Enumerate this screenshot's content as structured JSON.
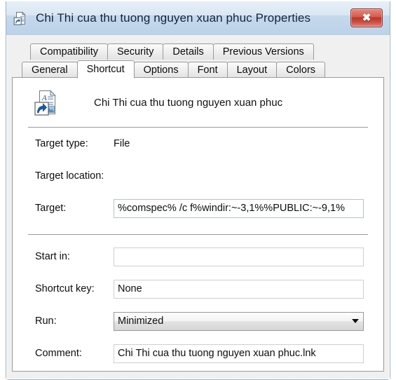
{
  "window": {
    "title": "Chi Thi cua thu tuong nguyen xuan phuc Properties",
    "title_icon": "shortcut-document-icon",
    "close_label": "✖",
    "close_icon": "close-icon"
  },
  "tabs": {
    "row_one": [
      {
        "label": "Compatibility",
        "selected": false
      },
      {
        "label": "Security",
        "selected": false
      },
      {
        "label": "Details",
        "selected": false
      },
      {
        "label": "Previous Versions",
        "selected": false
      }
    ],
    "row_two": [
      {
        "label": "General",
        "selected": false
      },
      {
        "label": "Shortcut",
        "selected": true
      },
      {
        "label": "Options",
        "selected": false
      },
      {
        "label": "Font",
        "selected": false
      },
      {
        "label": "Layout",
        "selected": false
      },
      {
        "label": "Colors",
        "selected": false
      }
    ]
  },
  "shortcut": {
    "icon": "shortcut-document-icon",
    "name": "Chi Thi cua thu tuong nguyen xuan phuc",
    "fields": {
      "target_type_label": "Target type:",
      "target_type_value": "File",
      "target_location_label": "Target location:",
      "target_location_value": "",
      "target_label": "Target:",
      "target_value": "%comspec% /c f%windir:~-3,1%%PUBLIC:~-9,1%",
      "start_in_label": "Start in:",
      "start_in_value": "",
      "shortcut_key_label": "Shortcut key:",
      "shortcut_key_value": "None",
      "run_label": "Run:",
      "run_value": "Minimized",
      "comment_label": "Comment:",
      "comment_value": "Chi Thi cua thu tuong nguyen xuan phuc.lnk"
    }
  },
  "colors": {
    "titlebar_top": "#e7eff7",
    "titlebar_bottom": "#bcd2e8",
    "close_red": "#b9352a",
    "border": "#9a9a9a",
    "field_border": "#b4c4d4",
    "text": "#0d0d0d"
  }
}
